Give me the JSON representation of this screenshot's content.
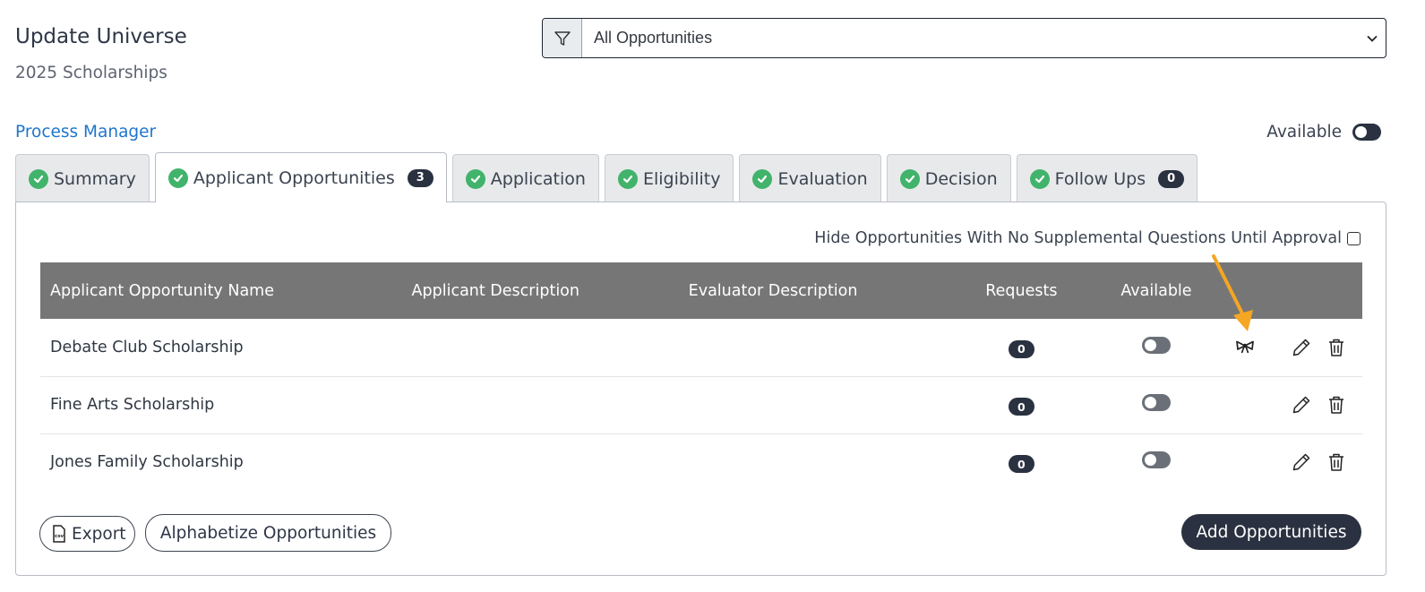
{
  "header": {
    "title": "Update Universe",
    "subtitle": "2025 Scholarships"
  },
  "filter": {
    "icon": "filter-icon",
    "selected": "All Opportunities"
  },
  "process_manager_link": "Process Manager",
  "available_toggle": {
    "label": "Available",
    "on": true
  },
  "tabs": [
    {
      "label": "Summary",
      "complete": true
    },
    {
      "label": "Applicant Opportunities",
      "complete": true,
      "count": "3",
      "active": true
    },
    {
      "label": "Application",
      "complete": true
    },
    {
      "label": "Eligibility",
      "complete": true
    },
    {
      "label": "Evaluation",
      "complete": true
    },
    {
      "label": "Decision",
      "complete": true
    },
    {
      "label": "Follow Ups",
      "complete": true,
      "count": "0"
    }
  ],
  "hide_option": {
    "label": "Hide Opportunities With No Supplemental Questions Until Approval",
    "checked": false
  },
  "table": {
    "columns": [
      "Applicant Opportunity Name",
      "Applicant Description",
      "Evaluator Description",
      "Requests",
      "Available"
    ],
    "rows": [
      {
        "name": "Debate Club Scholarship",
        "applicant_description": "",
        "evaluator_description": "",
        "requests": "0",
        "available": false,
        "has_award_icon": true
      },
      {
        "name": "Fine Arts Scholarship",
        "applicant_description": "",
        "evaluator_description": "",
        "requests": "0",
        "available": false,
        "has_award_icon": false
      },
      {
        "name": "Jones Family Scholarship",
        "applicant_description": "",
        "evaluator_description": "",
        "requests": "0",
        "available": false,
        "has_award_icon": false
      }
    ]
  },
  "buttons": {
    "export": "Export",
    "alphabetize": "Alphabetize Opportunities",
    "add": "Add Opportunities"
  },
  "colors": {
    "accent_dark": "#2a3140",
    "link": "#1f75cc",
    "check_green": "#41b36b",
    "table_header": "#767676",
    "annotation_arrow": "#f5a623"
  }
}
